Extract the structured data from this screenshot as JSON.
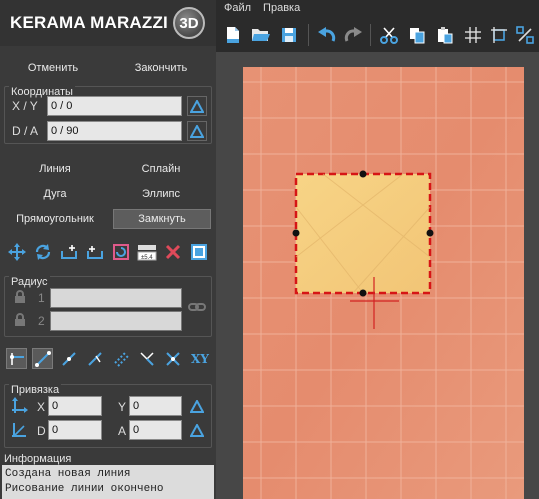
{
  "logo": {
    "text": "KERAMA MARAZZI",
    "badge": "3D"
  },
  "menu": {
    "items": [
      "Файл",
      "Правка"
    ]
  },
  "left": {
    "undo_label": "Отменить",
    "finish_label": "Закончить",
    "coords": {
      "title": "Координаты",
      "xy_label": "X / Y",
      "xy_value": "0 / 0",
      "da_label": "D / A",
      "da_value": "0 / 90"
    },
    "modes": {
      "line": "Линия",
      "spline": "Сплайн",
      "arc": "Дуга",
      "ellipse": "Эллипс",
      "rectangle": "Прямоугольник",
      "close": "Замкнуть"
    },
    "radius": {
      "title": "Радиус",
      "row1": "1",
      "row2": "2"
    },
    "snap": {
      "title": "Привязка",
      "x_label": "X",
      "x_value": "0",
      "y_label": "Y",
      "y_value": "0",
      "d_label": "D",
      "d_value": "0",
      "a_label": "A",
      "a_value": "0",
      "xy_button": "XY"
    },
    "info": {
      "title": "Информация",
      "lines": [
        "Создана новая линия",
        "Рисование линии окончено"
      ]
    }
  },
  "colors": {
    "panel_bg": "#3a3a3a",
    "accent_blue": "#4aa3e0",
    "floor": "#e69072",
    "selection_fill": "#f5cd7d",
    "selection_border": "#d61515",
    "cursor": "#d22222"
  }
}
